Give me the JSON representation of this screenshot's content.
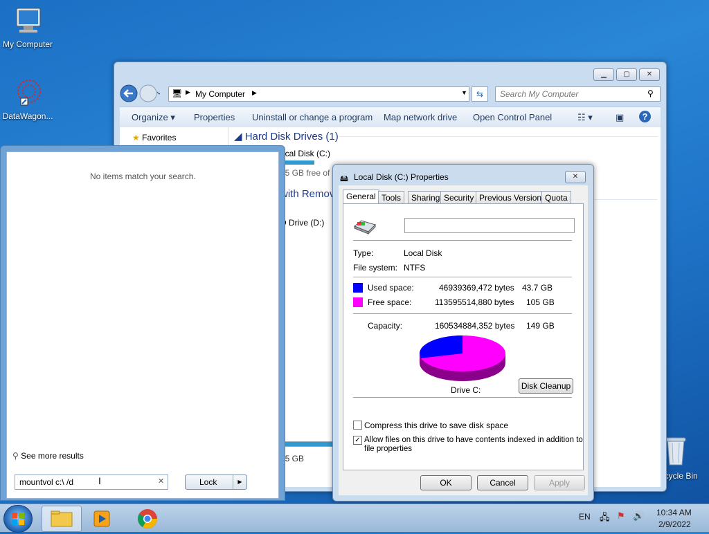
{
  "desktop": {
    "icons": [
      {
        "label": "My Computer"
      },
      {
        "label": "DataWagon..."
      },
      {
        "label": "Recycle Bin"
      }
    ]
  },
  "explorer": {
    "address": "My Computer",
    "search_placeholder": "Search My Computer",
    "toolbar": {
      "organize": "Organize",
      "properties": "Properties",
      "uninstall": "Uninstall or change a program",
      "map_drive": "Map network drive",
      "control_panel": "Open Control Panel"
    },
    "nav": {
      "favorites": "Favorites"
    },
    "content": {
      "hdd_group": "Hard Disk Drives (1)",
      "local_disk": "ocal Disk (C:)",
      "free_text": "05 GB free of 1",
      "removable_group": "with Remov",
      "dvd": "D Drive (D:)",
      "bottom_size": "05 GB"
    }
  },
  "startmenu": {
    "no_items": "No items match your search.",
    "see_more": "See more results",
    "search_value": "mountvol c:\\ /d",
    "lock": "Lock"
  },
  "dialog": {
    "title": "Local Disk (C:) Properties",
    "tabs": [
      "General",
      "Tools",
      "Sharing",
      "Security",
      "Previous Versions",
      "Quota"
    ],
    "type_label": "Type:",
    "type_value": "Local Disk",
    "fs_label": "File system:",
    "fs_value": "NTFS",
    "used_label": "Used space:",
    "used_bytes": "46939369,472 bytes",
    "used_gb": "43.7 GB",
    "free_label": "Free space:",
    "free_bytes": "113595514,880 bytes",
    "free_gb": "105 GB",
    "cap_label": "Capacity:",
    "cap_bytes": "160534884,352 bytes",
    "cap_gb": "149 GB",
    "drive_label": "Drive C:",
    "cleanup": "Disk Cleanup",
    "compress": "Compress this drive to save disk space",
    "index": "Allow files on this drive to have contents indexed in addition to",
    "index2": "file properties",
    "ok": "OK",
    "cancel": "Cancel",
    "apply": "Apply",
    "used_color": "#0000ff",
    "free_color": "#ff00ff",
    "used_fraction": 0.292
  },
  "taskbar": {
    "lang": "EN",
    "time": "10:34 AM",
    "date": "2/9/2022"
  }
}
